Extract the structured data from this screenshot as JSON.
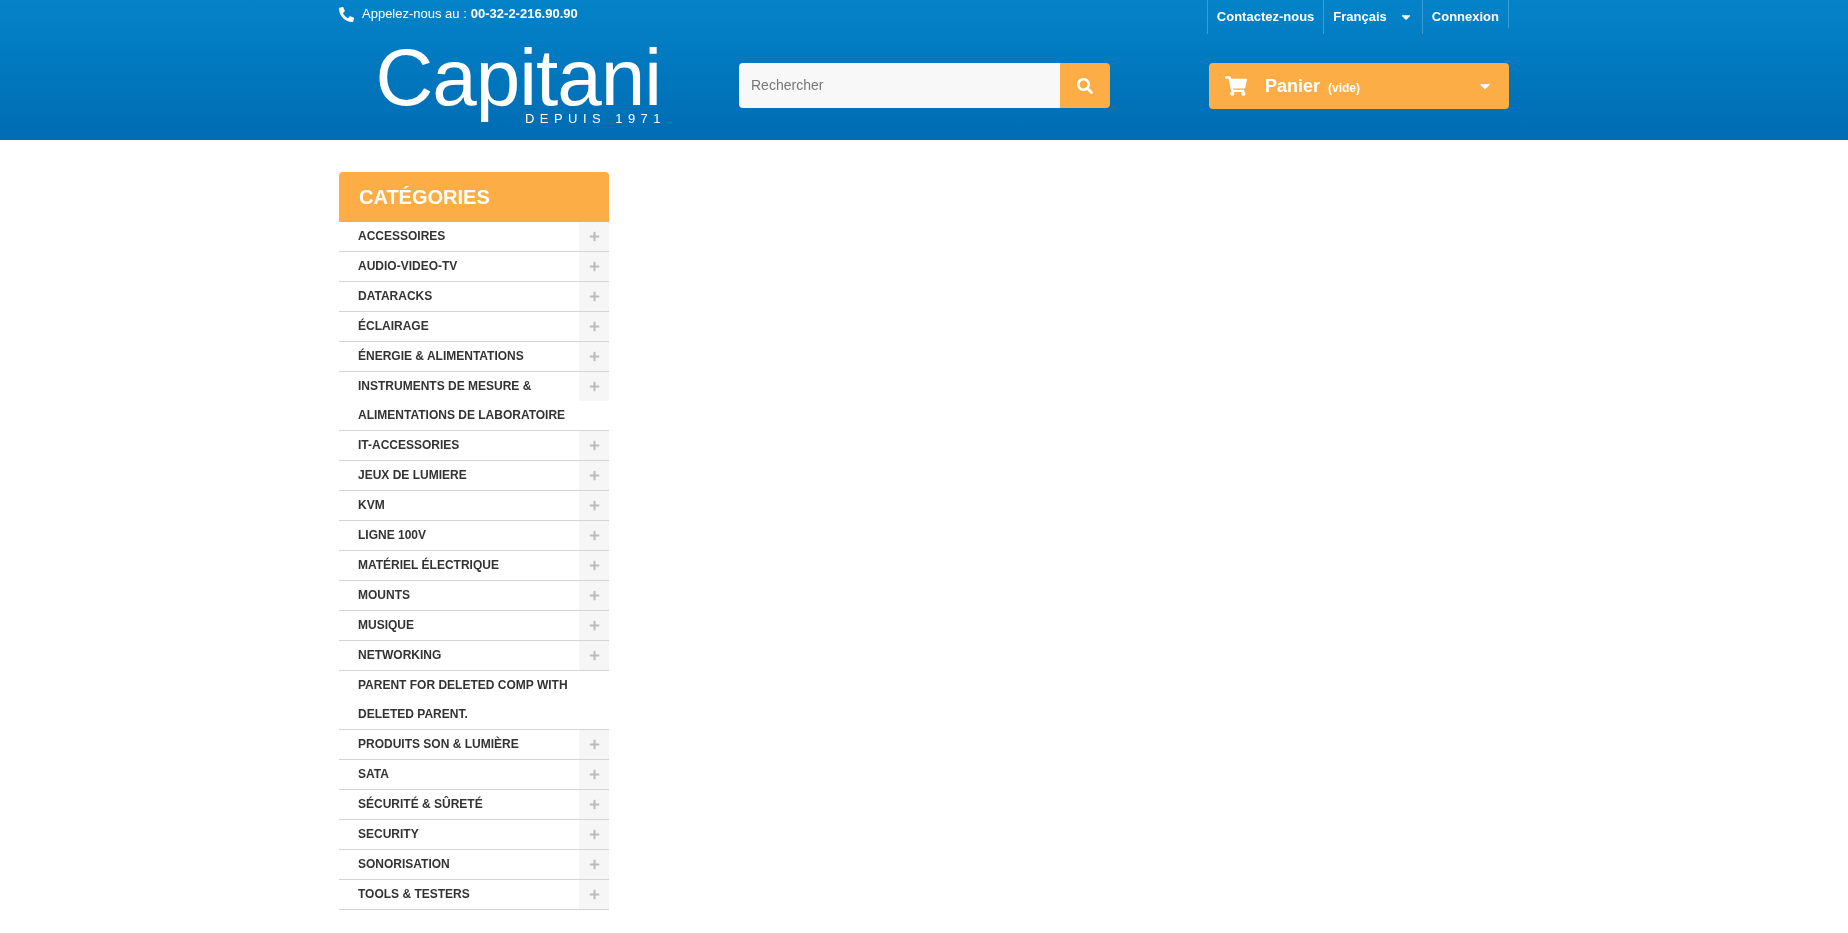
{
  "top_bar": {
    "phone_label": "Appelez-nous au :",
    "phone_number": "00-32-2-216.90.90",
    "links": [
      {
        "label": "Contactez-nous",
        "kind": "link"
      },
      {
        "label": "Français",
        "kind": "dropdown"
      },
      {
        "label": "Connexion",
        "kind": "link"
      }
    ]
  },
  "logo": {
    "name": "Capitani",
    "tagline": "DEPUIS 1971"
  },
  "search": {
    "placeholder": "Rechercher"
  },
  "cart": {
    "label": "Panier",
    "status": "(vide)"
  },
  "categories": {
    "title": "CATÉGORIES",
    "items": [
      {
        "label": "ACCESSOIRES",
        "expandable": true
      },
      {
        "label": "AUDIO-VIDEO-TV",
        "expandable": true
      },
      {
        "label": "DATARACKS",
        "expandable": true
      },
      {
        "label": "ÉCLAIRAGE",
        "expandable": true
      },
      {
        "label": "ÉNERGIE & ALIMENTATIONS",
        "expandable": true
      },
      {
        "label": "INSTRUMENTS DE MESURE & ALIMENTATIONS DE LABORATOIRE",
        "expandable": true
      },
      {
        "label": "IT-ACCESSORIES",
        "expandable": true
      },
      {
        "label": "JEUX DE LUMIERE",
        "expandable": true
      },
      {
        "label": "KVM",
        "expandable": true
      },
      {
        "label": "LIGNE 100V",
        "expandable": true
      },
      {
        "label": "MATÉRIEL ÉLECTRIQUE",
        "expandable": true
      },
      {
        "label": "MOUNTS",
        "expandable": true
      },
      {
        "label": "MUSIQUE",
        "expandable": true
      },
      {
        "label": "NETWORKING",
        "expandable": true
      },
      {
        "label": "PARENT FOR DELETED COMP WITH DELETED PARENT.",
        "expandable": false
      },
      {
        "label": "PRODUITS SON & LUMIÈRE",
        "expandable": true
      },
      {
        "label": "SATA",
        "expandable": true
      },
      {
        "label": "SÉCURITÉ & SÛRETÉ",
        "expandable": true
      },
      {
        "label": "SECURITY",
        "expandable": true
      },
      {
        "label": "SONORISATION",
        "expandable": true
      },
      {
        "label": "TOOLS & TESTERS",
        "expandable": true
      }
    ]
  }
}
